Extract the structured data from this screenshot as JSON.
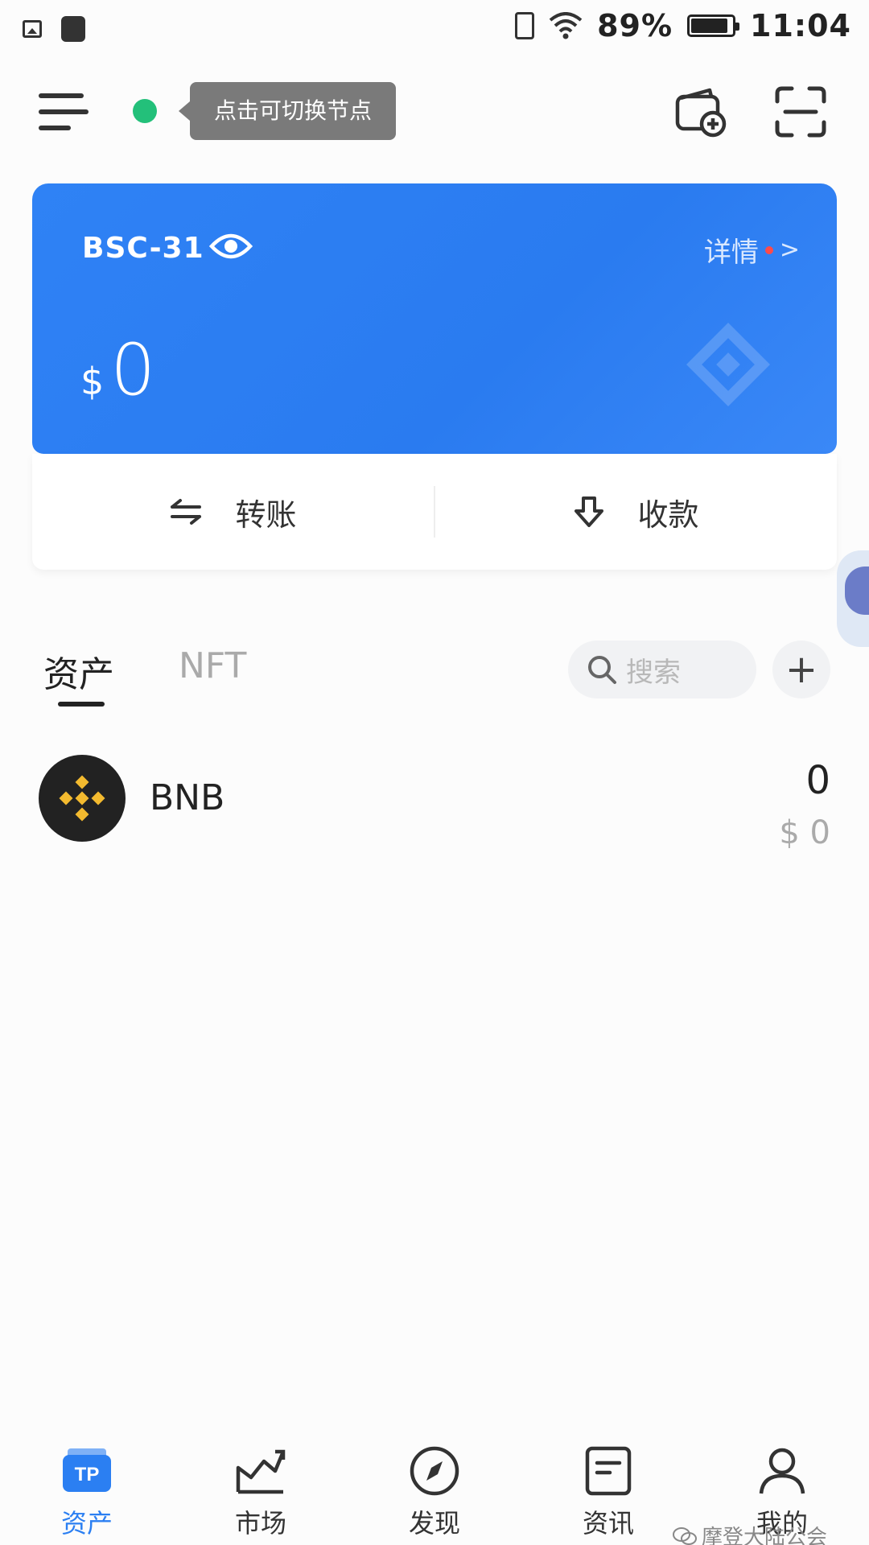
{
  "status_bar": {
    "battery_percent": "89%",
    "battery_level": 0.89,
    "time": "11:04"
  },
  "header": {
    "tooltip": "点击可切换节点",
    "node_status_color": "#23c07a"
  },
  "wallet_card": {
    "wallet_name": "BSC-31",
    "details_label": "详情",
    "details_chevron": ">",
    "balance_currency": "$",
    "balance_value": "0",
    "card_color": "#2f82f5"
  },
  "actions": {
    "transfer_label": "转账",
    "receive_label": "收款"
  },
  "tabs": {
    "assets_label": "资产",
    "nft_label": "NFT"
  },
  "search": {
    "placeholder": "搜索"
  },
  "add_token": {
    "label": "+"
  },
  "tokens": [
    {
      "symbol": "BNB",
      "amount": "0",
      "value": "$ 0",
      "logo_color": "#f3ba2f"
    }
  ],
  "bottom_nav": {
    "items": [
      {
        "label": "资产",
        "icon": "tp-wallet-icon",
        "active": true
      },
      {
        "label": "市场",
        "icon": "market-chart-icon",
        "active": false
      },
      {
        "label": "发现",
        "icon": "compass-icon",
        "active": false
      },
      {
        "label": "资讯",
        "icon": "news-icon",
        "active": false
      },
      {
        "label": "我的",
        "icon": "profile-icon",
        "active": false
      }
    ],
    "accent_color": "#2b7ff2"
  },
  "watermark": {
    "text": "摩登大陆公会"
  }
}
